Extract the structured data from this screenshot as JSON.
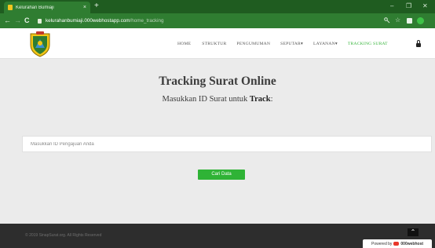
{
  "browser": {
    "tab_title": "Kelurahan Bumiaji",
    "tab_close": "×",
    "new_tab": "+",
    "back": "←",
    "forward": "→",
    "reload": "C",
    "url_host": "kelurahanbumiaji.000webhostapp.com",
    "url_path": "/home_tracking",
    "star": "☆",
    "window": {
      "minimize": "–",
      "maximize": "❐",
      "close": "✕"
    }
  },
  "nav": {
    "items": [
      "HOME",
      "STRUKTUR",
      "PENGUMUMAN",
      "SEPUTAR",
      "LAYANAN",
      "TRACKING SURAT"
    ],
    "active_index": 5,
    "active_color": "#35b43a"
  },
  "hero": {
    "title": "Tracking Surat Online",
    "subtitle_prefix": "Masukkan ID Surat untuk ",
    "subtitle_bold": "Track",
    "subtitle_suffix": ":"
  },
  "form": {
    "input_placeholder": "Masukkan ID Pengajuan Anda",
    "input_value": "",
    "button_label": "Cari Data",
    "button_color": "#2fb336"
  },
  "footer": {
    "copyright": "© 2019 SinapSurat.org. All Rights Reserved",
    "scroll_top": "⌃",
    "powered_by_prefix": "Powered by",
    "powered_by_brand": "000webhost"
  },
  "colors": {
    "browser_green": "#2f7d31",
    "page_bg": "#ebebeb",
    "footer_bg": "#2d2d2d"
  }
}
